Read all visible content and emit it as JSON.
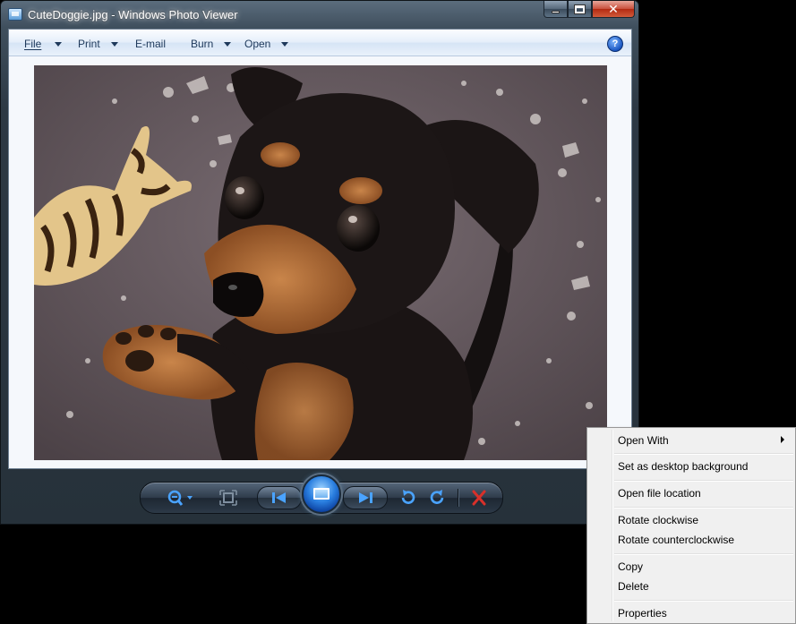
{
  "window": {
    "title": "CuteDoggie.jpg - Windows Photo Viewer",
    "close_glyph": "✕"
  },
  "menubar": {
    "items": [
      {
        "label": "File"
      },
      {
        "label": "Print"
      },
      {
        "label": "E-mail"
      },
      {
        "label": "Burn"
      },
      {
        "label": "Open"
      }
    ],
    "help_glyph": "?"
  },
  "controls": {
    "icons": [
      "magnifier-icon",
      "actual-size-icon",
      "previous-icon",
      "slideshow-icon",
      "next-icon",
      "rotate-counterclockwise-icon",
      "rotate-clockwise-icon",
      "delete-icon"
    ],
    "accent_color": "#2a7fe0",
    "delete_color": "#d8302a"
  },
  "context_menu": {
    "items": [
      {
        "label": "Open With",
        "submenu": true
      },
      {
        "label": "Set as desktop background"
      },
      {
        "label": "Open file location"
      },
      {
        "label": "Rotate clockwise"
      },
      {
        "label": "Rotate counterclockwise"
      },
      {
        "label": "Copy"
      },
      {
        "label": "Delete"
      },
      {
        "label": "Properties"
      }
    ]
  }
}
